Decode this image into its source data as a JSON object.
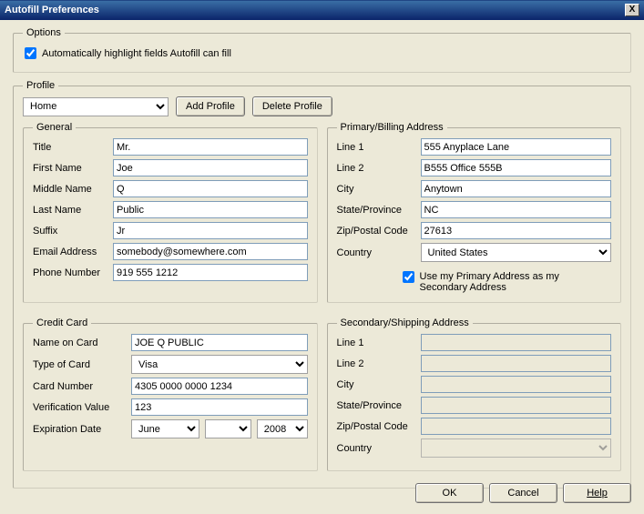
{
  "window": {
    "title": "Autofill Preferences",
    "close_label": "X"
  },
  "options": {
    "legend": "Options",
    "highlight_label": "Automatically highlight fields Autofill can fill"
  },
  "profile": {
    "legend": "Profile",
    "select_value": "Home",
    "add_label": "Add Profile",
    "delete_label": "Delete Profile"
  },
  "general": {
    "legend": "General",
    "title_label": "Title",
    "title_value": "Mr.",
    "first_label": "First Name",
    "first_value": "Joe",
    "middle_label": "Middle Name",
    "middle_value": "Q",
    "last_label": "Last Name",
    "last_value": "Public",
    "suffix_label": "Suffix",
    "suffix_value": "Jr",
    "email_label": "Email Address",
    "email_value": "somebody@somewhere.com",
    "phone_label": "Phone Number",
    "phone_value": "919 555 1212"
  },
  "primary": {
    "legend": "Primary/Billing Address",
    "line1_label": "Line 1",
    "line1_value": "555 Anyplace Lane",
    "line2_label": "Line 2",
    "line2_value": "B555 Office 555B",
    "city_label": "City",
    "city_value": "Anytown",
    "state_label": "State/Province",
    "state_value": "NC",
    "zip_label": "Zip/Postal Code",
    "zip_value": "27613",
    "country_label": "Country",
    "country_value": "United States",
    "use_primary_label": "Use my Primary Address as my Secondary Address"
  },
  "cc": {
    "legend": "Credit Card",
    "name_label": "Name on Card",
    "name_value": "JOE Q PUBLIC",
    "type_label": "Type of Card",
    "type_value": "Visa",
    "number_label": "Card Number",
    "number_value": "4305 0000 0000 1234",
    "cvv_label": "Verification Value",
    "cvv_value": "123",
    "exp_label": "Expiration Date",
    "exp_month": "June",
    "exp_day": "",
    "exp_year": "2008"
  },
  "secondary": {
    "legend": "Secondary/Shipping Address",
    "line1_label": "Line 1",
    "line1_value": "",
    "line2_label": "Line 2",
    "line2_value": "",
    "city_label": "City",
    "city_value": "",
    "state_label": "State/Province",
    "state_value": "",
    "zip_label": "Zip/Postal Code",
    "zip_value": "",
    "country_label": "Country",
    "country_value": ""
  },
  "footer": {
    "ok": "OK",
    "cancel": "Cancel",
    "help": "Help"
  }
}
